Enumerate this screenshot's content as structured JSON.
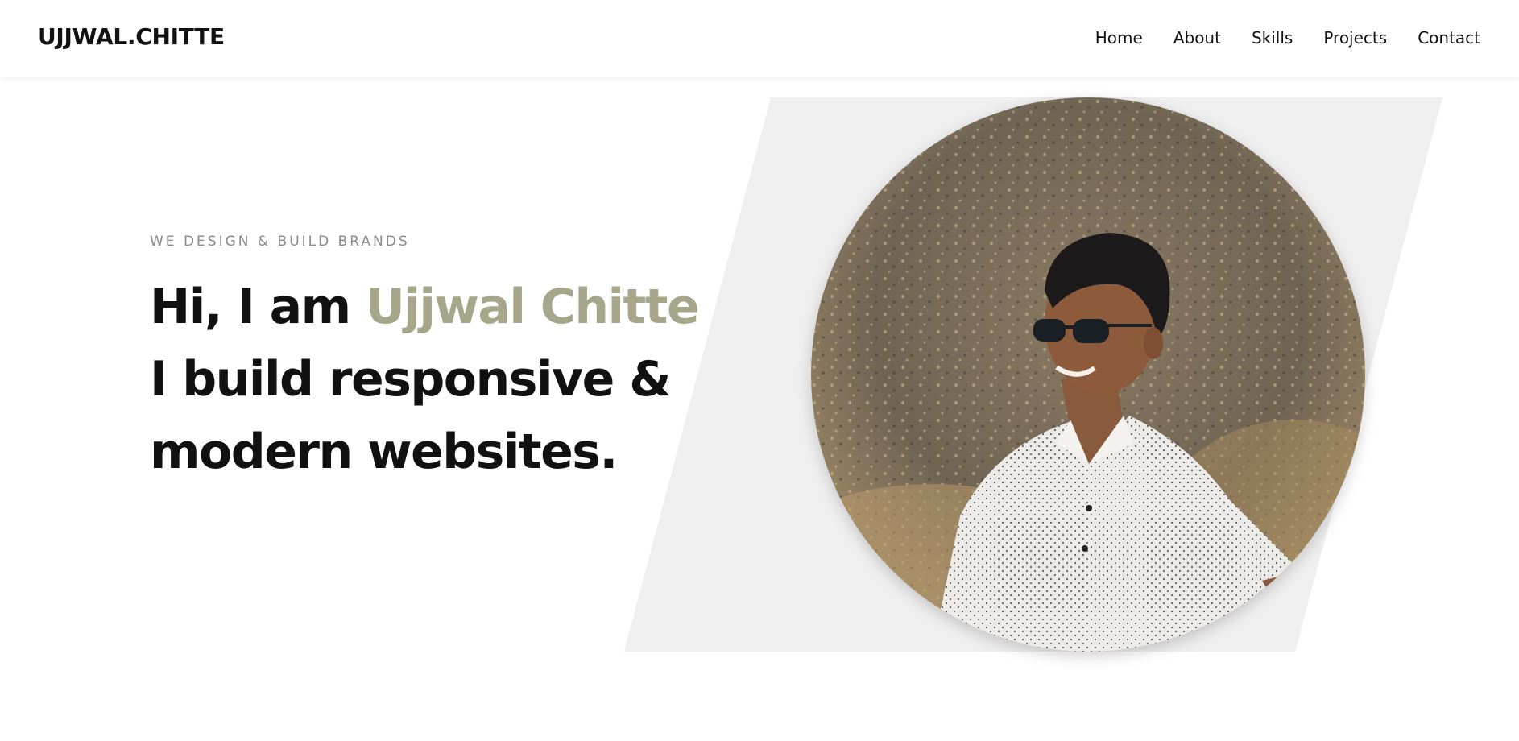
{
  "navbar": {
    "brand": "UJJWAL.CHITTE",
    "links": [
      "Home",
      "About",
      "Skills",
      "Projects",
      "Contact"
    ]
  },
  "hero": {
    "eyebrow": "WE DESIGN & BUILD BRANDS",
    "greeting": "Hi, I am ",
    "name": "Ujjwal Chitte",
    "line2": "I build responsive &",
    "line3": "modern websites."
  },
  "colors": {
    "accent": "#a7a58a",
    "text": "#111111",
    "muted": "#8a8a8a",
    "shape": "#efefef"
  },
  "portrait": {
    "alt": "portrait-photo"
  }
}
